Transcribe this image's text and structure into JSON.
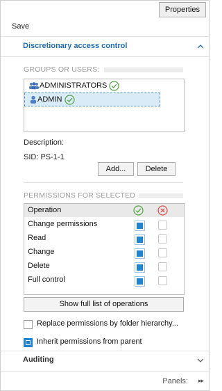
{
  "toolbar": {
    "properties_label": "Properties"
  },
  "save_label": "Save",
  "sections": {
    "dac": {
      "title": "Discretionary access control",
      "expanded": true
    },
    "auditing": {
      "title": "Auditing",
      "expanded": false
    }
  },
  "groups": {
    "label": "GROUPS OR USERS:",
    "users": [
      {
        "name": "ADMINISTRATORS",
        "type": "group",
        "verified": true,
        "selected": false
      },
      {
        "name": "ADMIN",
        "type": "user",
        "verified": true,
        "selected": true
      }
    ]
  },
  "details": {
    "description_label": "Description:",
    "sid_label": "SID:",
    "sid_value": "PS-1-1"
  },
  "buttons": {
    "add": "Add...",
    "delete": "Delete",
    "show_full": "Show full list of operations"
  },
  "permissions": {
    "label": "PERMISSIONS FOR SELECTED",
    "column_operation": "Operation",
    "allow_icon": "check-circle-icon",
    "deny_icon": "x-circle-icon",
    "rows": [
      {
        "label": "Change permissions",
        "allow": true,
        "deny": false
      },
      {
        "label": "Read",
        "allow": true,
        "deny": false
      },
      {
        "label": "Change",
        "allow": true,
        "deny": false
      },
      {
        "label": "Delete",
        "allow": true,
        "deny": false
      },
      {
        "label": "Full control",
        "allow": true,
        "deny": false
      }
    ]
  },
  "options": {
    "replace": {
      "label": "Replace permissions by folder hierarchy...",
      "checked": false
    },
    "inherit": {
      "label": "Inherit permissions from parent",
      "checked": true
    }
  },
  "footer": {
    "panels_label": "Panels:",
    "panels_icon": "double-chevron-right-icon"
  },
  "colors": {
    "accent": "#1f6db4",
    "checkbox": "#1e84d0",
    "allow": "#5aa64b",
    "deny": "#d9534f",
    "selection": "#d9ebf7"
  }
}
